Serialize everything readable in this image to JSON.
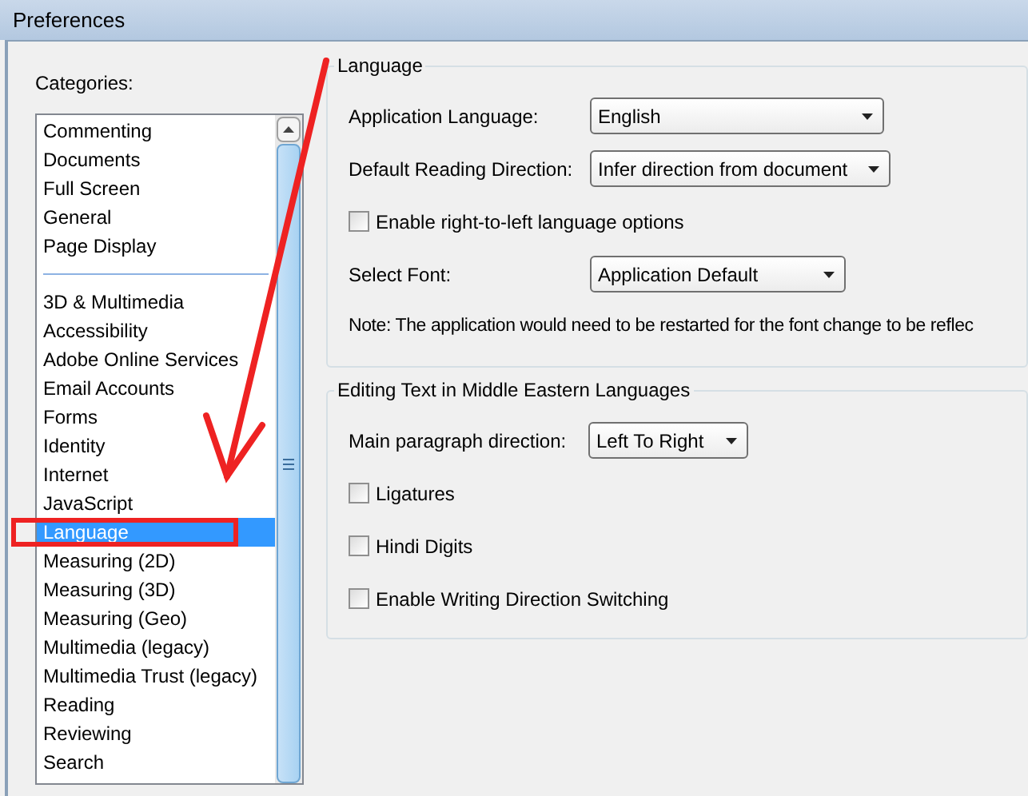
{
  "window": {
    "title": "Preferences"
  },
  "categories": {
    "label": "Categories:",
    "groups": [
      [
        {
          "label": "Commenting",
          "selected": false
        },
        {
          "label": "Documents",
          "selected": false
        },
        {
          "label": "Full Screen",
          "selected": false
        },
        {
          "label": "General",
          "selected": false
        },
        {
          "label": "Page Display",
          "selected": false
        }
      ],
      [
        {
          "label": "3D & Multimedia",
          "selected": false
        },
        {
          "label": "Accessibility",
          "selected": false
        },
        {
          "label": "Adobe Online Services",
          "selected": false
        },
        {
          "label": "Email Accounts",
          "selected": false
        },
        {
          "label": "Forms",
          "selected": false
        },
        {
          "label": "Identity",
          "selected": false
        },
        {
          "label": "Internet",
          "selected": false
        },
        {
          "label": "JavaScript",
          "selected": false
        },
        {
          "label": "Language",
          "selected": true
        },
        {
          "label": "Measuring (2D)",
          "selected": false
        },
        {
          "label": "Measuring (3D)",
          "selected": false
        },
        {
          "label": "Measuring (Geo)",
          "selected": false
        },
        {
          "label": "Multimedia (legacy)",
          "selected": false
        },
        {
          "label": "Multimedia Trust (legacy)",
          "selected": false
        },
        {
          "label": "Reading",
          "selected": false
        },
        {
          "label": "Reviewing",
          "selected": false
        },
        {
          "label": "Search",
          "selected": false
        }
      ]
    ]
  },
  "groups": [
    {
      "title": "Language",
      "rows": [
        {
          "kind": "select",
          "label": "Application Language:",
          "value": "English"
        },
        {
          "kind": "select",
          "label": "Default Reading Direction:",
          "value": "Infer direction from document"
        },
        {
          "kind": "checkbox",
          "label": "Enable right-to-left language options",
          "checked": false
        },
        {
          "kind": "select",
          "label": "Select Font:",
          "value": "Application Default"
        },
        {
          "kind": "note",
          "label": "Note: The application would need to be restarted for the font change to be reflec"
        }
      ]
    },
    {
      "title": "Editing Text in Middle Eastern Languages",
      "rows": [
        {
          "kind": "select",
          "label": "Main paragraph direction:",
          "value": "Left To Right"
        },
        {
          "kind": "checkbox",
          "label": "Ligatures",
          "checked": false
        },
        {
          "kind": "checkbox",
          "label": "Hindi Digits",
          "checked": false
        },
        {
          "kind": "checkbox",
          "label": "Enable Writing Direction Switching",
          "checked": false
        }
      ]
    }
  ]
}
